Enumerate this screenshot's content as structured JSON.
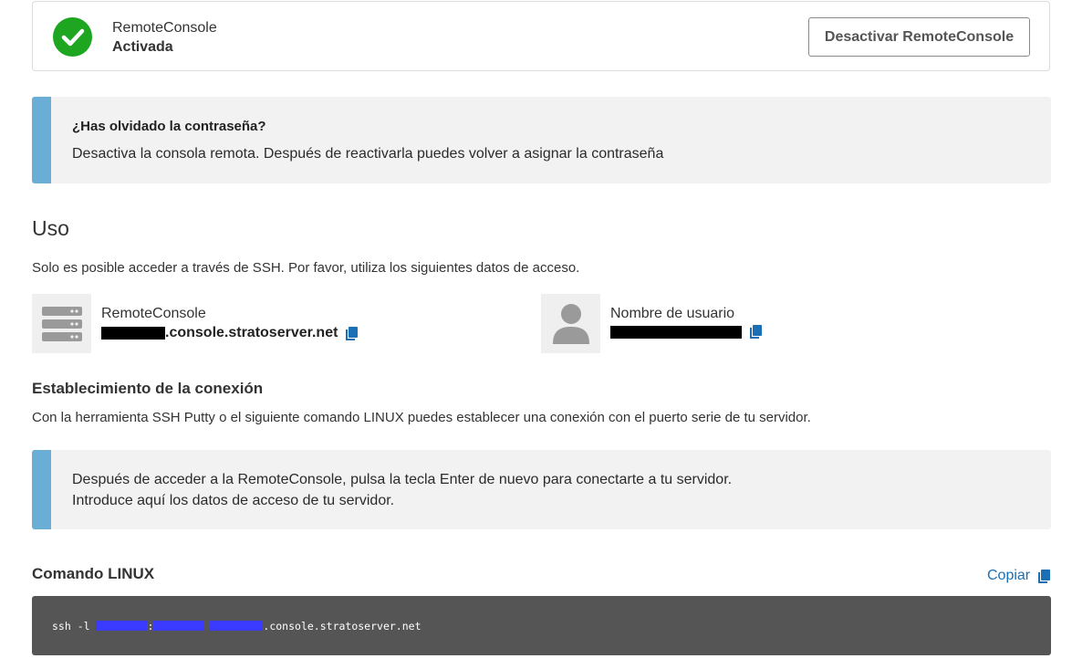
{
  "status": {
    "service_name": "RemoteConsole",
    "state": "Activada",
    "deactivate_label": "Desactivar RemoteConsole",
    "success_color": "#1ea620"
  },
  "password_notice": {
    "title": "¿Has olvidado la contraseña?",
    "text": "Desactiva la consola remota. Después de reactivarla puedes volver a asignar la contraseña"
  },
  "usage": {
    "heading": "Uso",
    "description": "Solo es posible acceder a través de SSH. Por favor, utiliza los siguientes datos de acceso.",
    "host": {
      "label": "RemoteConsole",
      "value_suffix": ".console.stratoserver.net",
      "icon": "server-icon"
    },
    "username": {
      "label": "Nombre de usuario",
      "icon": "user-icon"
    }
  },
  "connection": {
    "heading": "Establecimiento de la conexión",
    "description": "Con la herramienta SSH Putty o el siguiente comando LINUX puedes establecer una conexión con el puerto serie de tu servidor.",
    "notice_line1": "Después de acceder a la RemoteConsole, pulsa la tecla Enter de nuevo para conectarte a tu servidor.",
    "notice_line2": "Introduce aquí los datos de acceso de tu servidor."
  },
  "linux_command": {
    "heading": "Comando LINUX",
    "copy_label": "Copiar",
    "prefix": "ssh -l ",
    "separator": ":",
    "suffix": ".console.stratoserver.net"
  },
  "colors": {
    "accent": "#1a6fb5",
    "notice_bar": "#6aaed6",
    "command_bg": "#555555"
  }
}
